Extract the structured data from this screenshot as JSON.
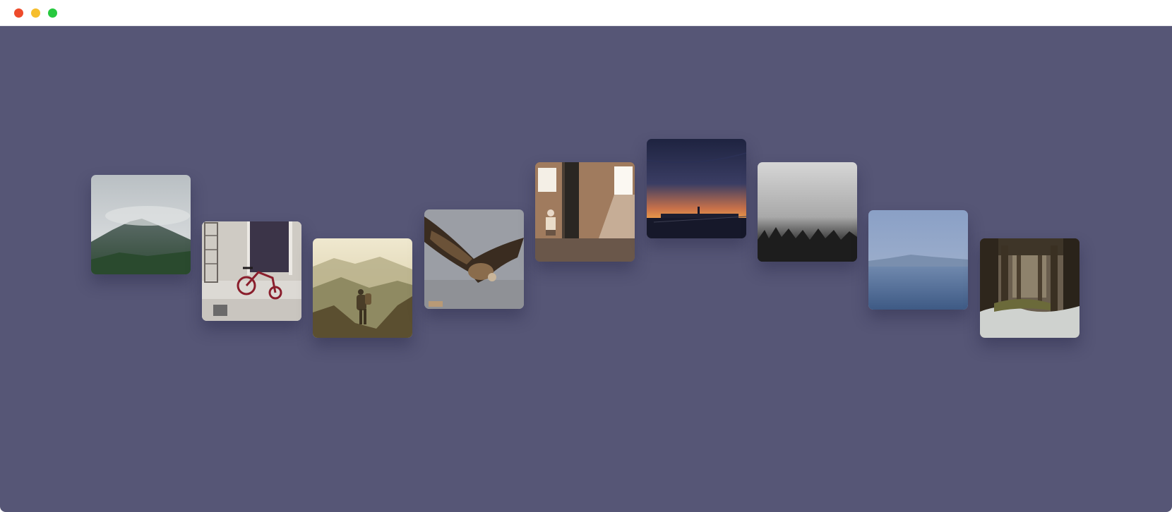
{
  "window": {
    "controls": {
      "close_color": "#ee4b2b",
      "minimize_color": "#f6be2d",
      "maximize_color": "#27c93f"
    },
    "background_color": "#565676"
  },
  "gallery": {
    "items": [
      {
        "subject": "misty-mountain"
      },
      {
        "subject": "tricycle-on-street"
      },
      {
        "subject": "hiker-on-ridge"
      },
      {
        "subject": "flying-vulture"
      },
      {
        "subject": "person-in-dusty-room"
      },
      {
        "subject": "pier-at-sunset"
      },
      {
        "subject": "foggy-forest"
      },
      {
        "subject": "calm-lake"
      },
      {
        "subject": "under-pier-waves"
      }
    ]
  }
}
